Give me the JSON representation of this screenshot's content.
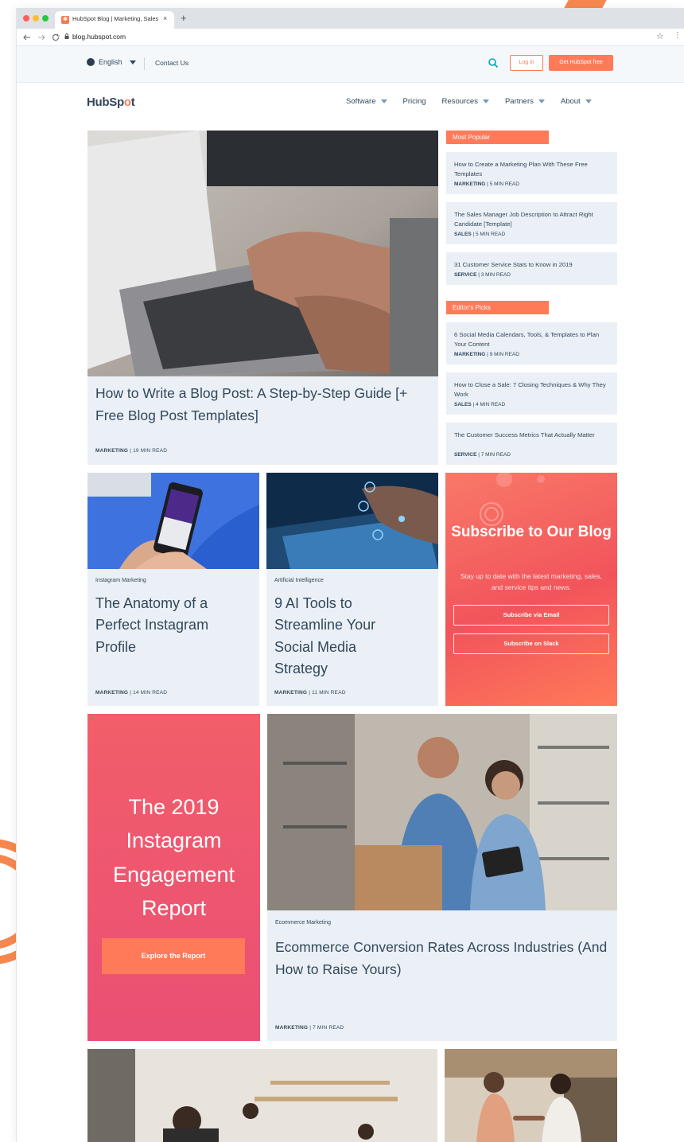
{
  "browser": {
    "tab_title": "HubSpot Blog | Marketing, Sales",
    "tab_close": "×",
    "new_tab": "+",
    "url": "blog.hubspot.com",
    "favicon_glyph": "✽"
  },
  "utility": {
    "language": "English",
    "contact": "Contact Us",
    "login": "Log in",
    "get_free": "Get HubSpot free"
  },
  "logo": {
    "prefix": "HubSp",
    "o": "o",
    "suffix": "t"
  },
  "nav": [
    {
      "label": "Software",
      "dropdown": true
    },
    {
      "label": "Pricing",
      "dropdown": false
    },
    {
      "label": "Resources",
      "dropdown": true
    },
    {
      "label": "Partners",
      "dropdown": true
    },
    {
      "label": "About",
      "dropdown": true
    }
  ],
  "featured": {
    "title": "How to Write a Blog Post: A Step-by-Step Guide [+ Free Blog Post Templates]",
    "category": "MARKETING",
    "read": "19 MIN READ"
  },
  "most_popular": {
    "label": "Most Popular",
    "items": [
      {
        "title": "How to Create a Marketing Plan With These Free Templates",
        "category": "MARKETING",
        "read": "5 MIN READ"
      },
      {
        "title": "The Sales Manager Job Description to Attract Right Candidate [Template]",
        "category": "SALES",
        "read": "5 MIN READ"
      },
      {
        "title": "31 Customer Service Stats to Know in 2019",
        "category": "SERVICE",
        "read": "3 MIN READ"
      }
    ]
  },
  "editors_picks": {
    "label": "Editor's Picks",
    "items": [
      {
        "title": "6 Social Media Calendars, Tools, & Templates to Plan Your Content",
        "category": "MARKETING",
        "read": "9 MIN READ"
      },
      {
        "title": "How to Close a Sale: 7 Closing Techniques & Why They Work",
        "category": "SALES",
        "read": "4 MIN READ"
      },
      {
        "title": "The Customer Success Metrics That Actually Matter",
        "category": "SERVICE",
        "read": "7 MIN READ"
      }
    ]
  },
  "cards": [
    {
      "topic": "Instagram Marketing",
      "title": "The Anatomy of a Perfect Instagram Profile",
      "category": "MARKETING",
      "read": "14 MIN READ"
    },
    {
      "topic": "Artificial Intelligence",
      "title": "9 AI Tools to Streamline Your Social Media Strategy",
      "category": "MARKETING",
      "read": "11 MIN READ"
    }
  ],
  "subscribe": {
    "title": "Subscribe to Our Blog",
    "description": "Stay up to date with the latest marketing, sales, and service tips and news.",
    "email_button": "Subscribe via Email",
    "slack_button": "Subscribe on Slack"
  },
  "report": {
    "title": "The 2019 Instagram Engagement Report",
    "button": "Explore the Report"
  },
  "ecommerce": {
    "topic": "Ecommerce Marketing",
    "title": "Ecommerce Conversion Rates Across Industries (And How to Raise Yours)",
    "category": "MARKETING",
    "read": "7 MIN READ"
  },
  "separator": "|",
  "colors": {
    "brand": "#ff7a59",
    "text": "#33475b",
    "card": "#eaf0f6",
    "report": "#f25e6a"
  }
}
